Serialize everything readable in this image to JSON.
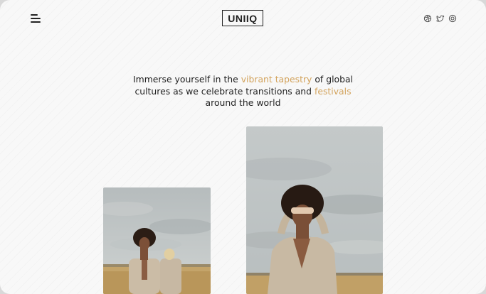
{
  "header": {
    "logo_text": "UNIIQ",
    "menu_icon": "menu-icon",
    "social_icons": [
      "dribbble-icon",
      "twitter-icon",
      "instagram-icon"
    ]
  },
  "hero": {
    "part1": "Immerse yourself in the ",
    "highlight1": "vibrant tapestry",
    "part2": " of global cultures as we celebrate transitions and ",
    "highlight2": "festivals",
    "part3": " around the world"
  },
  "colors": {
    "accent": "#d3a45e",
    "text": "#222222",
    "background": "#f8f8f8"
  },
  "gallery": {
    "images": [
      "photo-couple-field",
      "photo-hands-over-eyes"
    ]
  }
}
